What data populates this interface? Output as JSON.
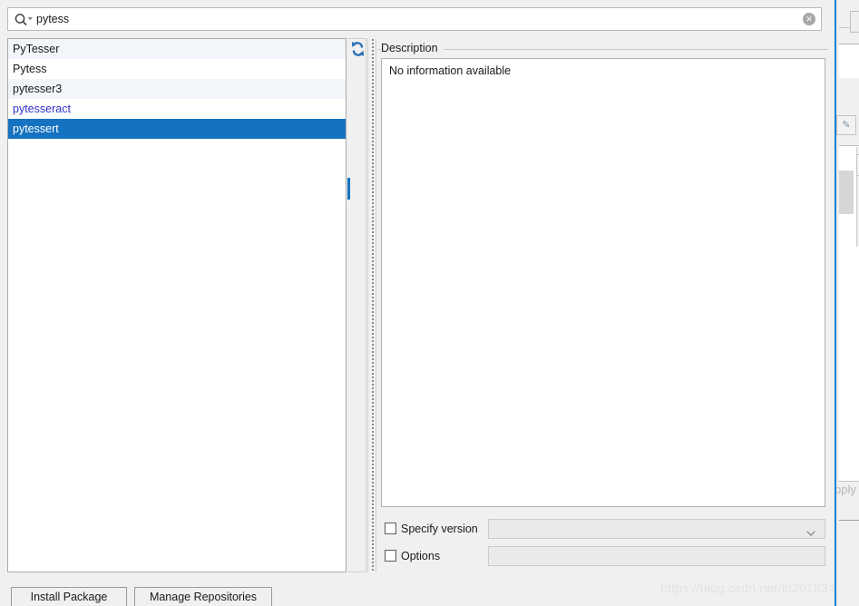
{
  "search": {
    "value": "pytess",
    "placeholder": "",
    "icon": "search-icon",
    "clear_icon": "clear-circle-icon"
  },
  "package_list": {
    "refresh_icon": "refresh-icon",
    "items": [
      {
        "name": "PyTesser",
        "style": "alt",
        "selected": false
      },
      {
        "name": "Pytess",
        "style": "plain",
        "selected": false
      },
      {
        "name": "pytesser3",
        "style": "alt",
        "selected": false
      },
      {
        "name": "pytesseract",
        "style": "link",
        "selected": false
      },
      {
        "name": "pytessert",
        "style": "plain",
        "selected": true
      }
    ]
  },
  "description": {
    "legend": "Description",
    "text": "No information available"
  },
  "options_section": {
    "specify_version": {
      "label": "Specify version",
      "checked": false,
      "value": "",
      "chevron_icon": "chevron-down-icon"
    },
    "options": {
      "label": "Options",
      "checked": false,
      "value": ""
    }
  },
  "buttons": {
    "install_package": "Install Package",
    "manage_repositories": "Manage Repositories"
  },
  "background": {
    "apply_label": "pply",
    "add_icon": "plus-icon",
    "remove_icon": "minus-icon",
    "up_icon": "arrow-up-icon",
    "pencil_icon": "pencil-icon",
    "gear_icon": "gear-icon"
  },
  "watermark": {
    "text": "https://blog.csdn.net/ltf201834"
  },
  "colors": {
    "selection_blue": "#1572c0",
    "link_blue": "#3232c8",
    "dialog_border": "#1a7fd4",
    "alt_row": "#f2f5f9",
    "panel_bg": "#f0f0f0"
  }
}
